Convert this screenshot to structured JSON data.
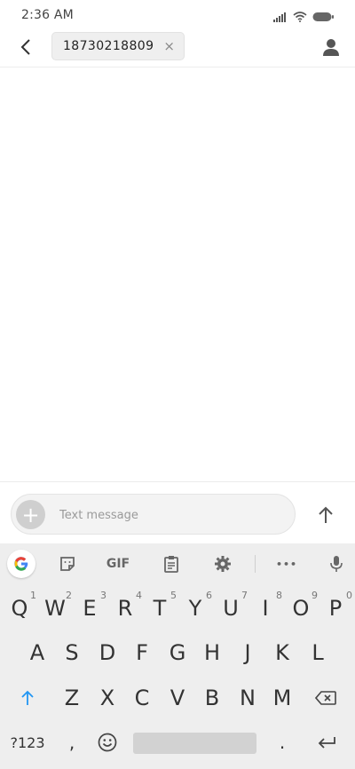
{
  "status_bar": {
    "time": "2:36 AM"
  },
  "header": {
    "recipient": "18730218809",
    "chip_close": "×"
  },
  "compose": {
    "placeholder": "Text message",
    "attach_symbol": "+"
  },
  "keyboard": {
    "toolbar": {
      "gif_label": "GIF",
      "more_label": "•••"
    },
    "row1": [
      {
        "key": "Q",
        "hint": "1"
      },
      {
        "key": "W",
        "hint": "2"
      },
      {
        "key": "E",
        "hint": "3"
      },
      {
        "key": "R",
        "hint": "4"
      },
      {
        "key": "T",
        "hint": "5"
      },
      {
        "key": "Y",
        "hint": "6"
      },
      {
        "key": "U",
        "hint": "7"
      },
      {
        "key": "I",
        "hint": "8"
      },
      {
        "key": "O",
        "hint": "9"
      },
      {
        "key": "P",
        "hint": "0"
      }
    ],
    "row2": [
      "A",
      "S",
      "D",
      "F",
      "G",
      "H",
      "J",
      "K",
      "L"
    ],
    "row3": [
      "Z",
      "X",
      "C",
      "V",
      "B",
      "N",
      "M"
    ],
    "row4": {
      "symbols": "?123",
      "comma": ",",
      "period": "."
    }
  },
  "colors": {
    "accent_blue": "#2196f3",
    "keyboard_bg": "#eeeeee"
  }
}
